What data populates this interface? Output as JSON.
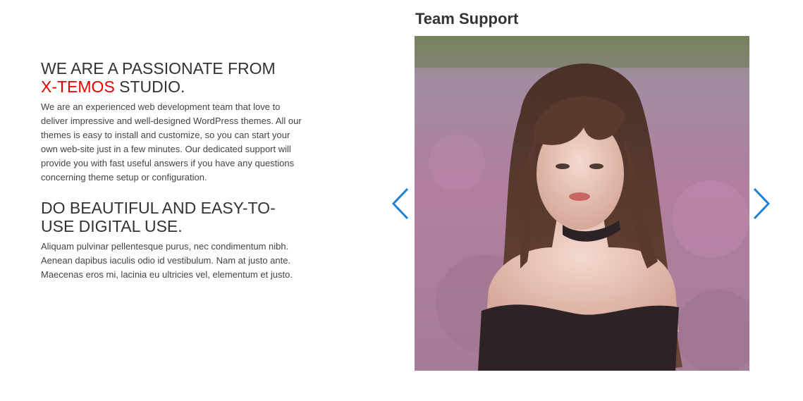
{
  "about": {
    "heading1_pre": "WE ARE A PASSIONATE FROM",
    "heading1_accent": "X-TEMOS",
    "heading1_post": "STUDIO.",
    "paragraph1": "We are an experienced web development team that love to deliver impressive and well-designed WordPress themes. All our themes is easy to install and customize, so you can start your own web-site just in a few minutes. Our dedicated support will provide you with fast useful answers if you have any questions concerning theme setup or configuration.",
    "heading2": "DO BEAUTIFUL AND EASY-TO-USE DIGITAL USE.",
    "paragraph2": "Aliquam pulvinar pellentesque purus, nec condimentum nibh. Aenean dapibus iaculis odio id vestibulum. Nam at justo ante. Maecenas eros mi, lacinia eu ultricies vel, elementum et justo."
  },
  "team": {
    "title": "Team Support"
  },
  "slider": {
    "prev_icon": "chevron-left-icon",
    "next_icon": "chevron-right-icon"
  },
  "colors": {
    "accent": "#e60000",
    "arrow": "#1e7fd6",
    "text": "#333333"
  }
}
